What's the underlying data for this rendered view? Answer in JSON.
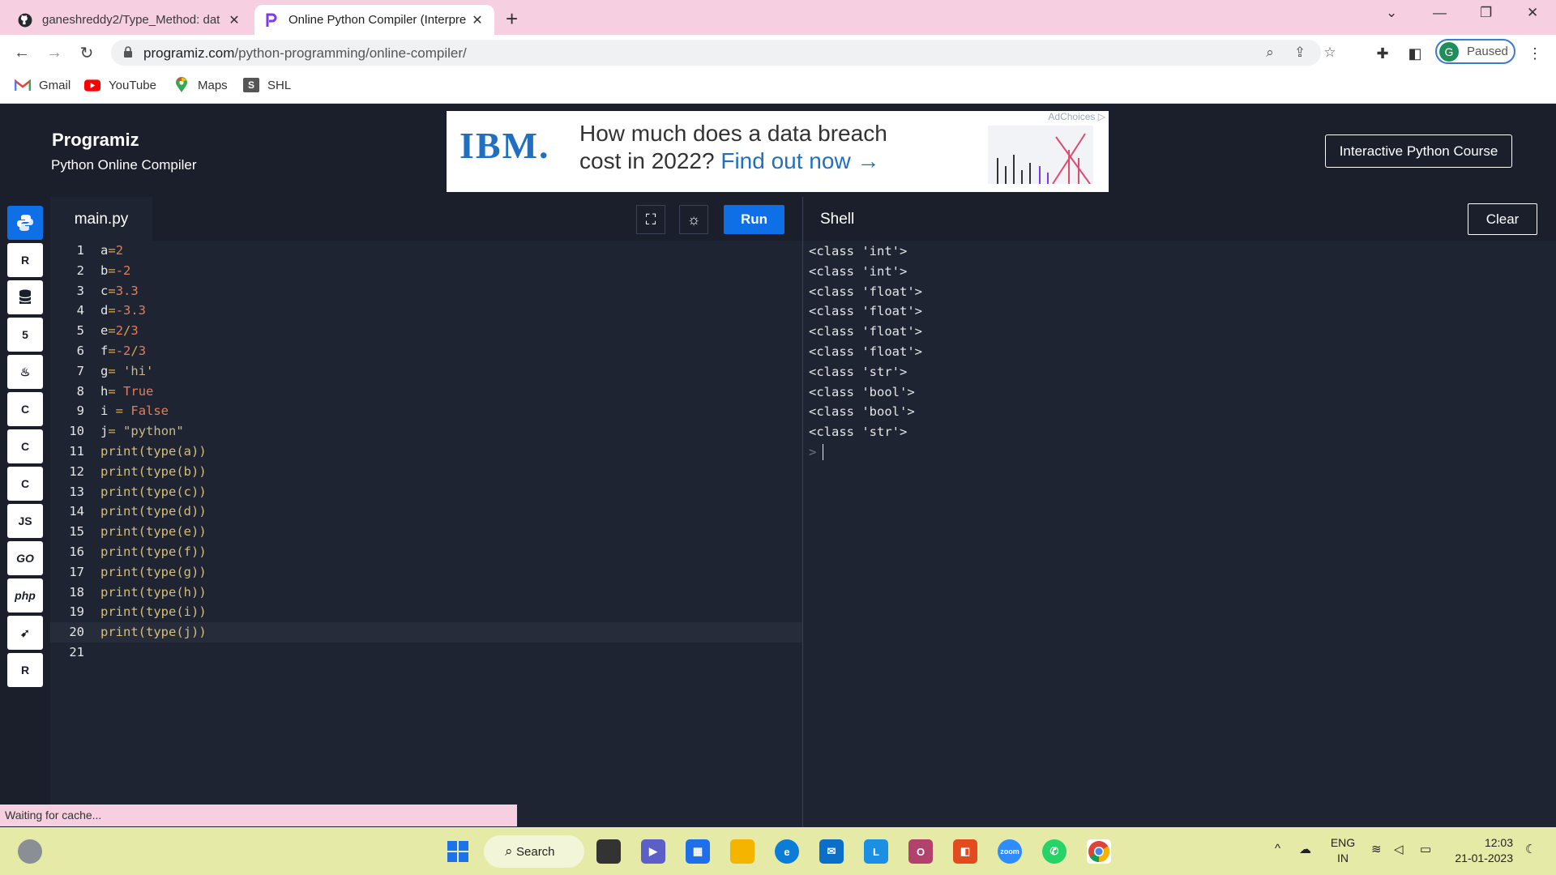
{
  "browser": {
    "tabs": [
      {
        "title": "ganeshreddy2/Type_Method: dat",
        "favicon": "github-icon"
      },
      {
        "title": "Online Python Compiler (Interpre",
        "favicon": "programiz-icon",
        "active": true
      }
    ],
    "url_host": "programiz.com",
    "url_path": "/python-programming/online-compiler/",
    "profile": {
      "initial": "G",
      "label": "Paused"
    },
    "bookmarks": [
      {
        "label": "Gmail",
        "icon": "gmail-icon"
      },
      {
        "label": "YouTube",
        "icon": "youtube-icon"
      },
      {
        "label": "Maps",
        "icon": "maps-icon"
      },
      {
        "label": "SHL",
        "icon": "shl-icon"
      }
    ]
  },
  "header": {
    "logo": "Programiz",
    "subtitle": "Python Online Compiler",
    "course_button": "Interactive Python Course"
  },
  "ad": {
    "brand": "IBM.",
    "line1": "How much does a data breach",
    "line2_prefix": "cost in 2022?",
    "cta": "Find out now →",
    "adchoices": "AdChoices"
  },
  "languages": [
    "python",
    "r",
    "sql",
    "html",
    "java",
    "c",
    "cpp",
    "csharp",
    "js",
    "go",
    "php",
    "swift",
    "rust"
  ],
  "editor": {
    "filename": "main.py",
    "run_label": "Run",
    "lines": [
      "1",
      "2",
      "3",
      "4",
      "5",
      "6",
      "7",
      "8",
      "9",
      "10",
      "11",
      "12",
      "13",
      "14",
      "15",
      "16",
      "17",
      "18",
      "19",
      "20",
      "21"
    ]
  },
  "shell": {
    "title": "Shell",
    "clear_label": "Clear",
    "output": [
      "<class 'int'>",
      "<class 'int'>",
      "<class 'float'>",
      "<class 'float'>",
      "<class 'float'>",
      "<class 'float'>",
      "<class 'str'>",
      "<class 'bool'>",
      "<class 'bool'>",
      "<class 'str'>"
    ],
    "prompt": ">"
  },
  "status": "Waiting for cache...",
  "taskbar": {
    "search_label": "Search",
    "lang": "ENG",
    "region": "IN",
    "time": "12:03",
    "date": "21-01-2023"
  }
}
